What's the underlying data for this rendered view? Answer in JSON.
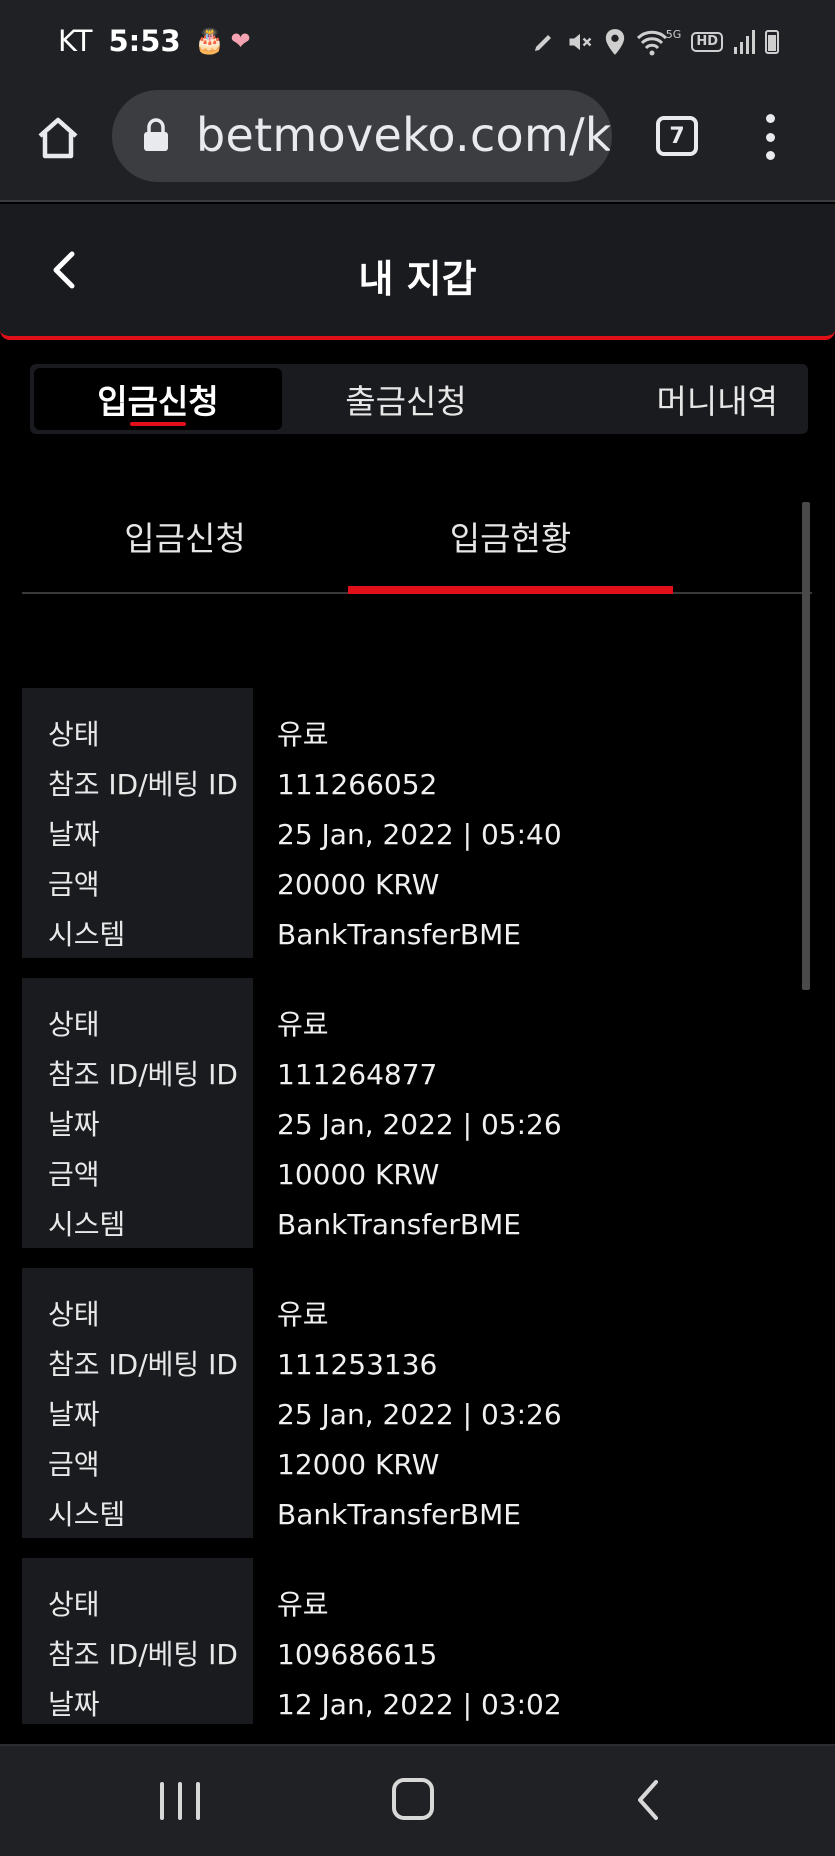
{
  "status_bar": {
    "carrier": "KT",
    "time": "5:53",
    "notification_icons": [
      "cake-emoji",
      "heart-emoji"
    ],
    "cake_glyph": "🎂",
    "heart_glyph": "❤",
    "hd_label": "HD",
    "network_label": "5G",
    "system_icons": [
      "pen-icon",
      "mute-icon",
      "location-icon",
      "wifi-icon",
      "hd-voice-icon",
      "signal-icon",
      "battery-icon"
    ]
  },
  "browser": {
    "url": "betmoveko.com/kc",
    "tab_count": "7"
  },
  "header": {
    "title": "내 지갑"
  },
  "top_tabs": [
    {
      "label": "입금신청",
      "active": true
    },
    {
      "label": "출금신청",
      "active": false
    },
    {
      "label": "머니내역",
      "active": false
    }
  ],
  "sub_tabs": [
    {
      "label": "입금신청",
      "active": false
    },
    {
      "label": "입금현황",
      "active": true
    }
  ],
  "field_labels": {
    "status": "상태",
    "reference_id": "참조 ID/베팅 ID",
    "date": "날짜",
    "amount": "금액",
    "system": "시스템"
  },
  "records": [
    {
      "status": "유료",
      "reference_id": "111266052",
      "date": "25 Jan, 2022 | 05:40",
      "amount": "20000 KRW",
      "system": "BankTransferBME"
    },
    {
      "status": "유료",
      "reference_id": "111264877",
      "date": "25 Jan, 2022 | 05:26",
      "amount": "10000 KRW",
      "system": "BankTransferBME"
    },
    {
      "status": "유료",
      "reference_id": "111253136",
      "date": "25 Jan, 2022 | 03:26",
      "amount": "12000 KRW",
      "system": "BankTransferBME"
    },
    {
      "status": "유료",
      "reference_id": "109686615",
      "date": "12 Jan, 2022 | 03:02"
    }
  ],
  "colors": {
    "accent": "#e10f17",
    "panel": "#1a1b1f",
    "background": "#000000"
  }
}
